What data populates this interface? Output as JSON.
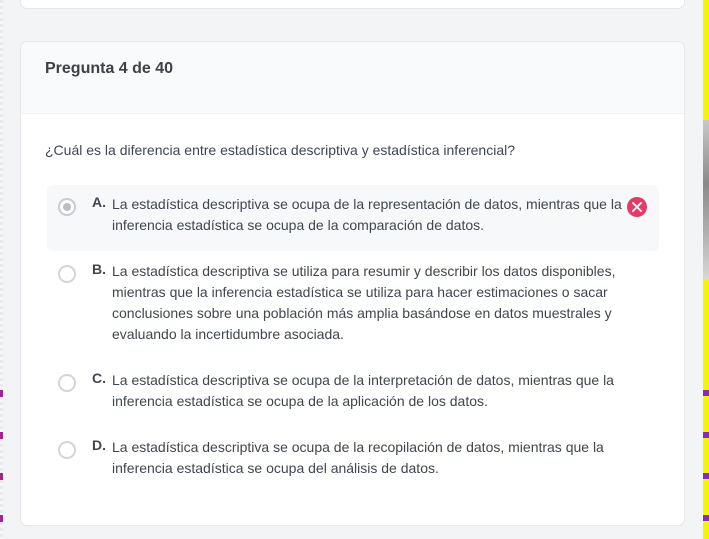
{
  "quiz": {
    "header": "Pregunta 4 de 40",
    "question": "¿Cuál es la diferencia entre estadística descriptiva y estadística inferencial?",
    "options": [
      {
        "letter": "A.",
        "text": "La estadística descriptiva se ocupa de la representación de datos, mientras que la inferencia estadística se ocupa de la comparación de datos.",
        "selected": true,
        "status": "incorrect"
      },
      {
        "letter": "B.",
        "text": "La estadística descriptiva se utiliza para resumir y describir los datos disponibles, mientras que la inferencia estadística se utiliza para hacer estimaciones o sacar conclusiones sobre una población más amplia basándose en datos muestrales y evaluando la incertidumbre asociada.",
        "selected": false
      },
      {
        "letter": "C.",
        "text": "La estadística descriptiva se ocupa de la interpretación de datos, mientras que la inferencia estadística se ocupa de la aplicación de los datos.",
        "selected": false
      },
      {
        "letter": "D.",
        "text": "La estadística descriptiva se ocupa de la recopilación de datos, mientras que la inferencia estadística se ocupa del análisis de datos.",
        "selected": false
      }
    ]
  },
  "icons": {
    "incorrect": "close-circle-icon"
  },
  "colors": {
    "incorrect": "#e23d68",
    "selected_bg": "#f7f8fa",
    "card_header_bg": "#f9fafb"
  }
}
